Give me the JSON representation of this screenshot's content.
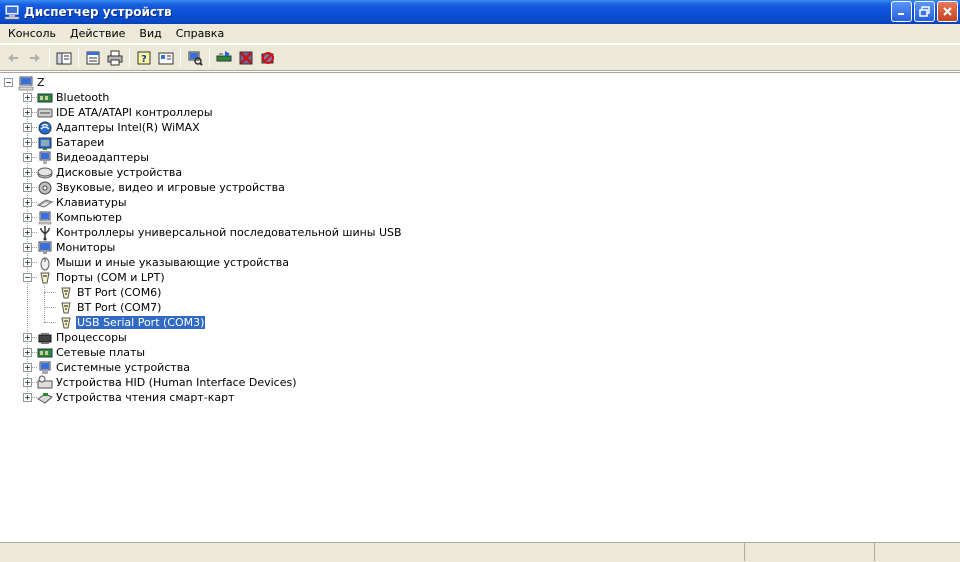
{
  "window": {
    "title": "Диспетчер устройств"
  },
  "menu": [
    "Консоль",
    "Действие",
    "Вид",
    "Справка"
  ],
  "toolbar": {
    "buttons": [
      "back-icon",
      "forward-icon",
      "console-tree-icon",
      "properties-icon",
      "print-icon",
      "help-icon",
      "view-icon",
      "scan-hardware-icon",
      "update-driver-icon",
      "disable-device-icon",
      "uninstall-device-icon"
    ]
  },
  "tree": {
    "root": "Z",
    "categories": [
      "Bluetooth",
      "IDE ATA/ATAPI контроллеры",
      "Адаптеры Intel(R) WiMAX",
      "Батареи",
      "Видеоадаптеры",
      "Дисковые устройства",
      "Звуковые, видео и игровые устройства",
      "Клавиатуры",
      "Компьютер",
      "Контроллеры универсальной последовательной шины USB",
      "Мониторы",
      "Мыши и иные указывающие устройства",
      "Порты (COM и LPT)",
      "Процессоры",
      "Сетевые платы",
      "Системные устройства",
      "Устройства HID (Human Interface Devices)",
      "Устройства чтения смарт-карт"
    ],
    "ports_children": [
      "BT Port (COM6)",
      "BT Port (COM7)",
      "USB Serial Port (COM3)"
    ],
    "selected": "USB Serial Port (COM3)"
  },
  "colors": {
    "titlebar": "#0a4fd6",
    "selection": "#316ac5",
    "chrome": "#ece9d8"
  }
}
